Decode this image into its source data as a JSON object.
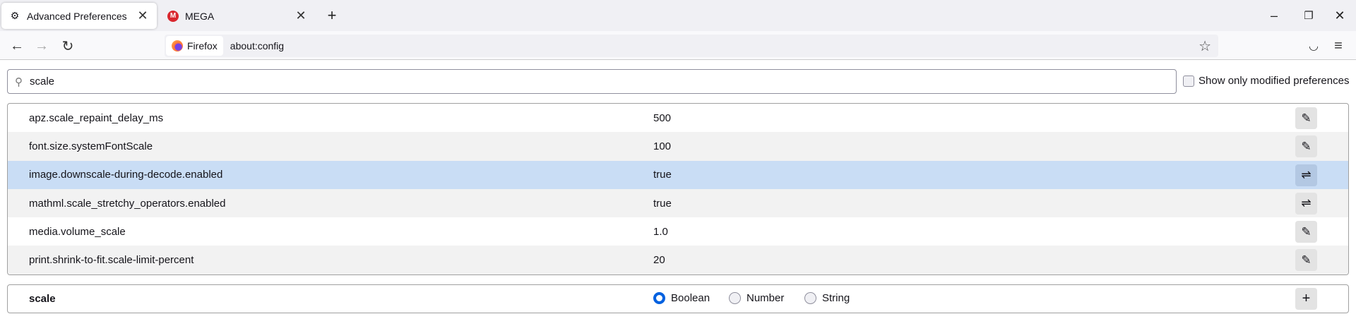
{
  "tabs": [
    {
      "title": "Advanced Preferences",
      "icon": "gear-icon",
      "active": true
    },
    {
      "title": "MEGA",
      "icon": "mega-icon",
      "active": false
    }
  ],
  "nav": {
    "identity": "Firefox",
    "url": "about:config"
  },
  "search": {
    "value": "scale"
  },
  "filter": {
    "label": "Show only modified preferences",
    "checked": false
  },
  "prefs": [
    {
      "name": "apz.scale_repaint_delay_ms",
      "value": "500",
      "action": "edit"
    },
    {
      "name": "font.size.systemFontScale",
      "value": "100",
      "action": "edit"
    },
    {
      "name": "image.downscale-during-decode.enabled",
      "value": "true",
      "action": "toggle",
      "selected": true
    },
    {
      "name": "mathml.scale_stretchy_operators.enabled",
      "value": "true",
      "action": "toggle"
    },
    {
      "name": "media.volume_scale",
      "value": "1.0",
      "action": "edit"
    },
    {
      "name": "print.shrink-to-fit.scale-limit-percent",
      "value": "20",
      "action": "edit"
    }
  ],
  "add": {
    "name": "scale",
    "types": [
      "Boolean",
      "Number",
      "String"
    ],
    "selected": "Boolean"
  },
  "colors": {
    "accent": "#0061e0",
    "selected_row": "#c9ddf5"
  }
}
